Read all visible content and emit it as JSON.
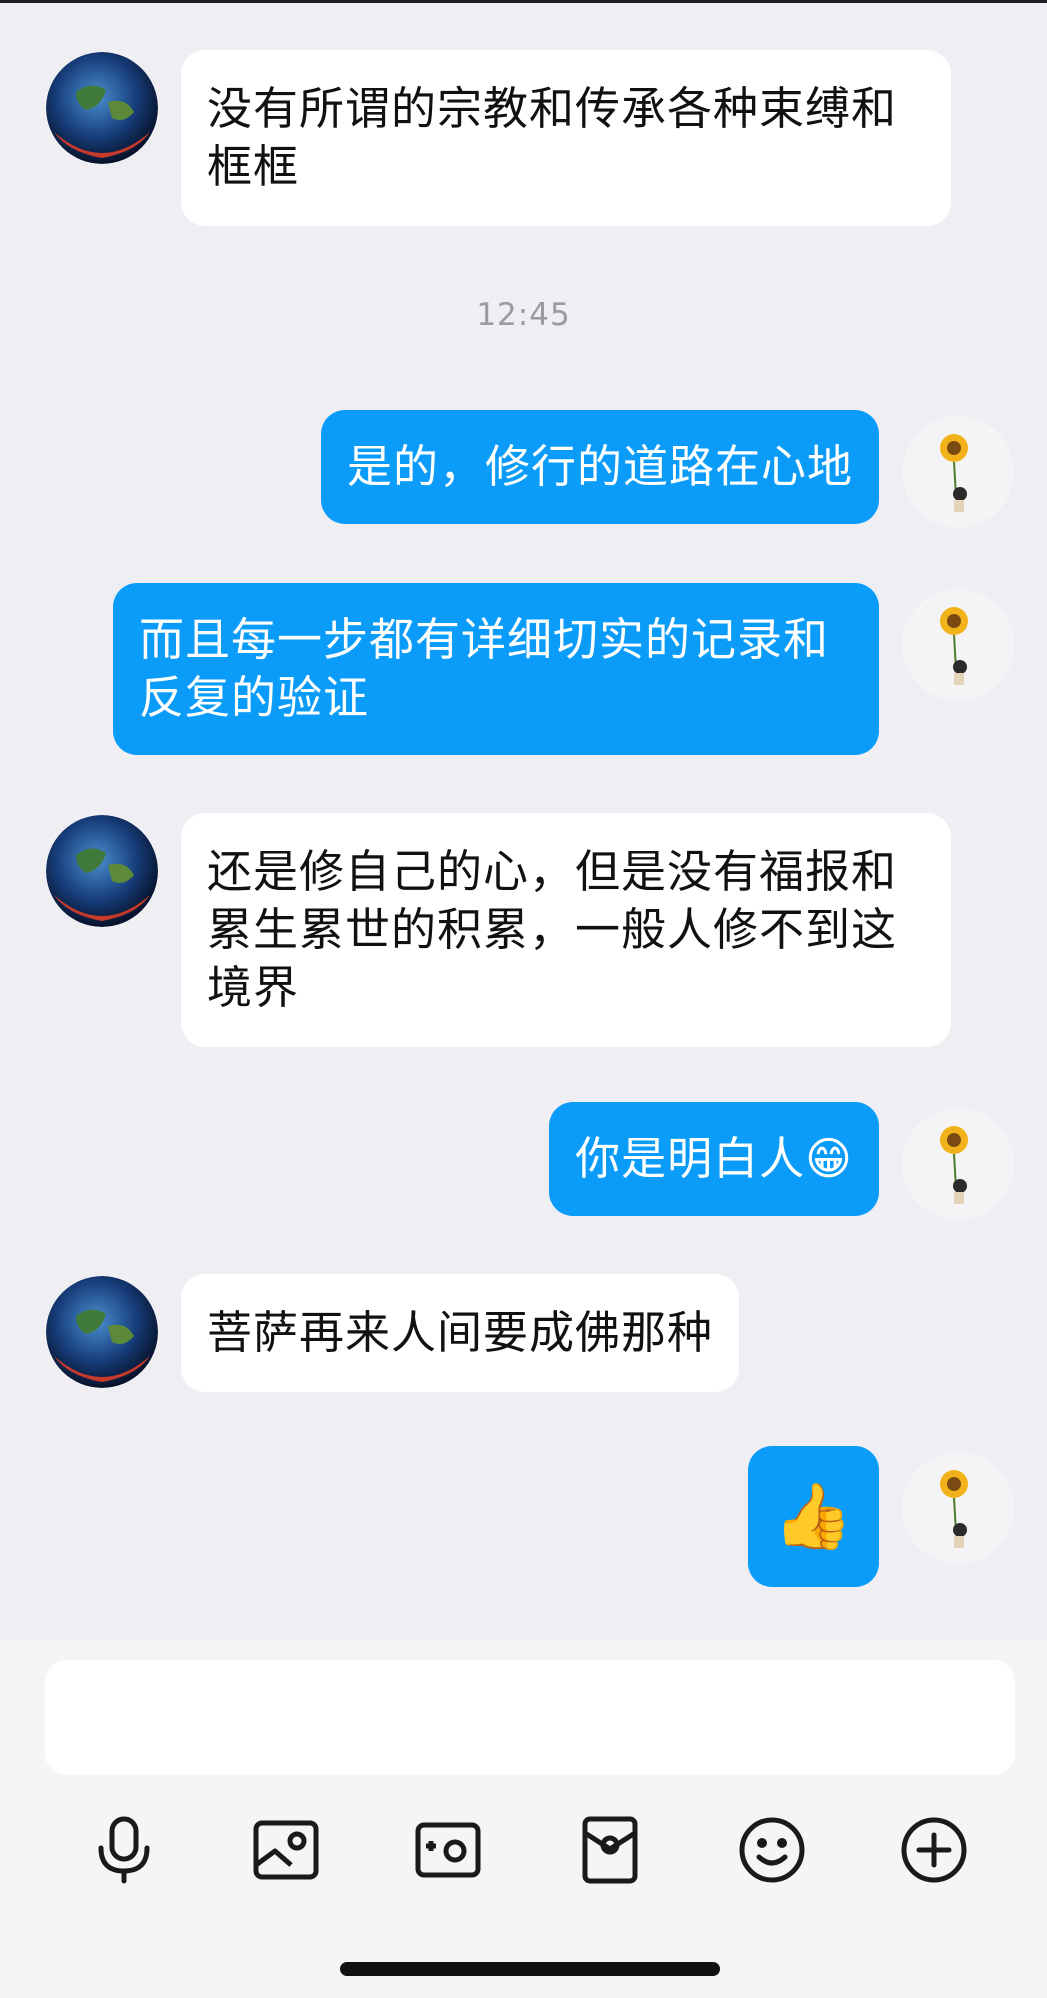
{
  "conversation": {
    "messages": [
      {
        "direction": "incoming",
        "text": "没有所谓的宗教和传承各种束缚和框框"
      },
      {
        "direction": "outgoing",
        "text": "是的，修行的道路在心地"
      },
      {
        "direction": "outgoing",
        "text": "而且每一步都有详细切实的记录和反复的验证"
      },
      {
        "direction": "incoming",
        "text": "还是修自己的心，但是没有福报和累生累世的积累，一般人修不到这境界"
      },
      {
        "direction": "outgoing",
        "text": "你是明白人",
        "emoji": "😁"
      },
      {
        "direction": "incoming",
        "text": "菩萨再来人间要成佛那种"
      },
      {
        "direction": "outgoing",
        "text": "👍"
      }
    ],
    "timestamp": "12:45"
  },
  "composer": {
    "input_value": "",
    "tools": [
      "microphone-icon",
      "image-icon",
      "camera-icon",
      "red-packet-icon",
      "emoji-icon",
      "plus-icon"
    ]
  },
  "colors": {
    "background": "#eeeef3",
    "outgoing_bubble": "#0a9cf8",
    "incoming_bubble": "#ffffff",
    "icon_stroke": "#1a1a1a"
  }
}
